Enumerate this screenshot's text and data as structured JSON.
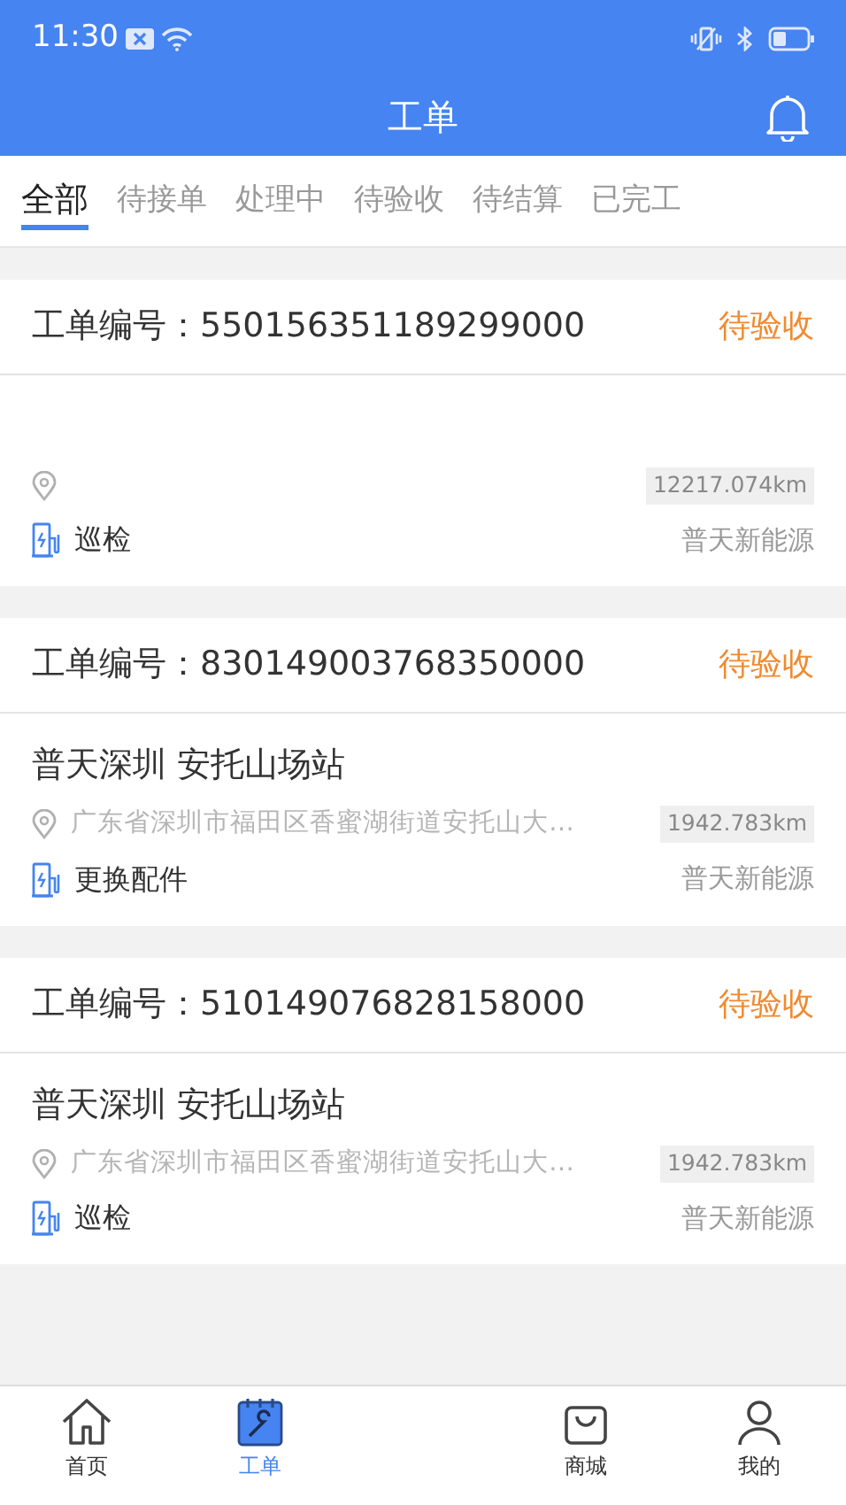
{
  "status_bar": {
    "time": "11:30"
  },
  "header": {
    "title": "工单"
  },
  "tabs": [
    {
      "label": "全部",
      "selected": true
    },
    {
      "label": "待接单",
      "selected": false
    },
    {
      "label": "处理中",
      "selected": false
    },
    {
      "label": "待验收",
      "selected": false
    },
    {
      "label": "待结算",
      "selected": false
    },
    {
      "label": "已完工",
      "selected": false
    }
  ],
  "orders": [
    {
      "number_label": "工单编号：550156351189299000",
      "status": "待验收",
      "distance": "12217.074km",
      "type": "巡检",
      "company": "普天新能源"
    },
    {
      "number_label": "工单编号：830149003768350000",
      "status": "待验收",
      "station": "普天深圳 安托山场站",
      "address": "广东省深圳市福田区香蜜湖街道安托山大…",
      "distance": "1942.783km",
      "type": "更换配件",
      "company": "普天新能源"
    },
    {
      "number_label": "工单编号：510149076828158000",
      "status": "待验收",
      "station": "普天深圳 安托山场站",
      "address": "广东省深圳市福田区香蜜湖街道安托山大…",
      "distance": "1942.783km",
      "type": "巡检",
      "company": "普天新能源"
    }
  ],
  "bottom_nav": [
    {
      "kind": "home",
      "label": "首页",
      "selected": false
    },
    {
      "kind": "orders",
      "label": "工单",
      "selected": true
    },
    {
      "kind": "hidden"
    },
    {
      "kind": "shop",
      "label": "商城",
      "selected": false
    },
    {
      "kind": "me",
      "label": "我的",
      "selected": false
    }
  ]
}
